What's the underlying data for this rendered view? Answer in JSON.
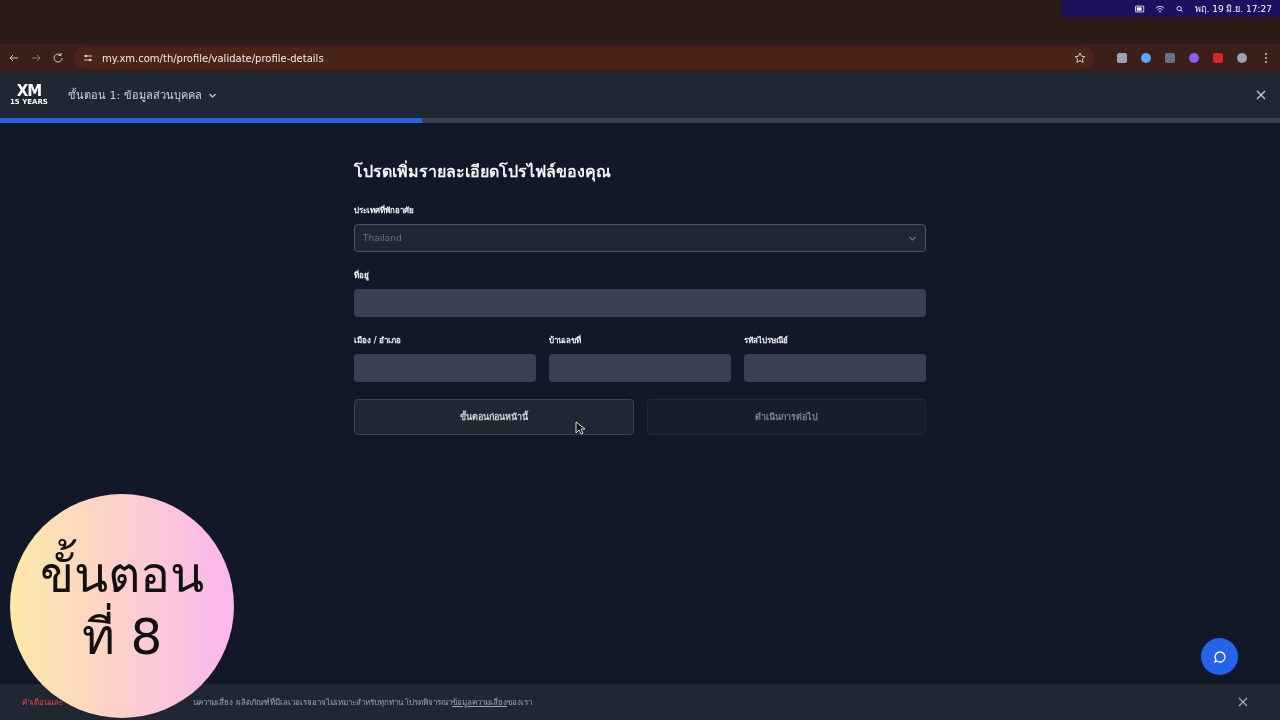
{
  "system_bar": {
    "clock": "พฤ. 19 มิ.ย.  17:27"
  },
  "browser": {
    "url": "my.xm.com/th/profile/validate/profile-details"
  },
  "header": {
    "logo": "XM",
    "logo_sub": "15 YEARS",
    "step": "ขั้นตอน 1: ข้อมูลส่วนบุคคล",
    "progress": {
      "level": 0.33
    }
  },
  "form": {
    "title": "โปรดเพิ่มรายละเอียดโปรไฟล์ของคุณ",
    "country": {
      "label": "ประเทศที่พักอาศัย",
      "value": "Thailand"
    },
    "address": {
      "label": "ที่อยู่"
    },
    "row_fields": [
      {
        "label": "เมือง / อำเภอ"
      },
      {
        "label": "บ้านเลขที่"
      },
      {
        "label": "รหัสไปรษณีย์"
      }
    ],
    "buttons": [
      {
        "label": "ขั้นตอนก่อนหน้านี้",
        "disabled": false
      },
      {
        "label": "ดำเนินการต่อไป",
        "disabled": true
      }
    ]
  },
  "risk_banner": {
    "warning": "คำเตือนและ",
    "text_before_link": "นความเสี่ยง ผลิตภัณฑ์ที่มีเลเวอเรจอาจไม่เหมาะสำหรับทุกท่าน โปรดพิจารณา",
    "link": "ข้อมูลความเสี่ยง",
    "text_after_link": "ของเรา"
  },
  "step_badge": {
    "line_1": "ขั้นตอน",
    "line_2": "ที่ 8"
  }
}
